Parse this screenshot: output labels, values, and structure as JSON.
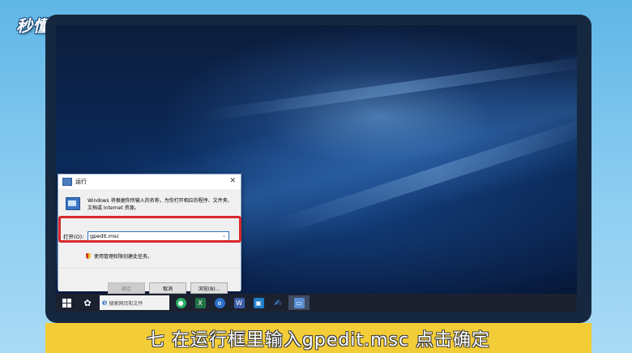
{
  "logo": {
    "text": "秒懂视频"
  },
  "run_dialog": {
    "title": "运行",
    "close": "✕",
    "description": "Windows 将根据你所输入的名称，为你打开相应的程序、文件夹、文档或 Internet 资源。",
    "open_label": "打开(O):",
    "open_value": "gpedit.msc",
    "dropdown": "⌄",
    "admin_note": "使用管理权限创建此任务。",
    "ok_button": "确定",
    "cancel_button": "取消",
    "browse_button": "浏览(B)..."
  },
  "taskbar": {
    "search_icon": "e",
    "search_text": "搜索网页和文件",
    "apps": [
      "wechat-icon",
      "excel-icon",
      "browser-icon",
      "word-icon",
      "app-icon",
      "pin-icon",
      "run-icon"
    ]
  },
  "caption": {
    "text": "七  在运行框里输入gpedit.msc  点击确定"
  },
  "colors": {
    "caption_bg": "#f3cd37",
    "highlight": "#d8282c",
    "frame": "#16283f"
  }
}
